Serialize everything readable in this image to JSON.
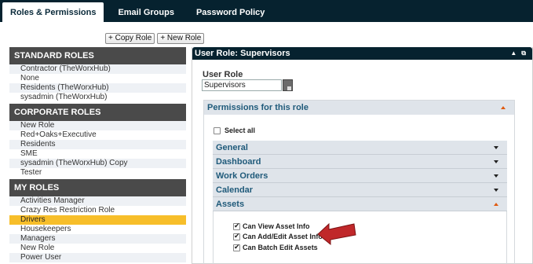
{
  "nav": {
    "tabs": [
      {
        "label": "Roles & Permissions"
      },
      {
        "label": "Email Groups"
      },
      {
        "label": "Password Policy"
      }
    ]
  },
  "toolbar": {
    "copy_role": "+ Copy Role",
    "new_role": "+ New Role"
  },
  "role_groups": [
    {
      "title": "STANDARD ROLES",
      "items": [
        "Contractor (TheWorxHub)",
        "None",
        "Residents (TheWorxHub)",
        "sysadmin (TheWorxHub)"
      ]
    },
    {
      "title": "CORPORATE ROLES",
      "items": [
        "New Role",
        "Red+Oaks+Executive",
        "Residents",
        "SME",
        "sysadmin (TheWorxHub) Copy",
        "Tester"
      ]
    },
    {
      "title": "MY ROLES",
      "items": [
        "Activities Manager",
        "Crazy Res Restriction Role",
        "Drivers",
        "Housekeepers",
        "Managers",
        "New Role",
        "Power User"
      ]
    }
  ],
  "selected_role": "Drivers",
  "panel": {
    "title": "User Role: Supervisors",
    "controls": [
      "▲",
      "⧉"
    ],
    "role_label": "User Role",
    "role_value": "Supervisors",
    "permissions_title": "Permissions for this role",
    "select_all": "Select all",
    "sections": [
      {
        "label": "General",
        "expanded": false
      },
      {
        "label": "Dashboard",
        "expanded": false
      },
      {
        "label": "Work Orders",
        "expanded": false
      },
      {
        "label": "Calendar",
        "expanded": false
      },
      {
        "label": "Assets",
        "expanded": true
      }
    ],
    "asset_permissions": [
      {
        "label": "Can View Asset Info",
        "checked": true
      },
      {
        "label": "Can Add/Edit Asset Info",
        "checked": true
      },
      {
        "label": "Can Batch Edit Assets",
        "checked": true
      }
    ]
  },
  "colors": {
    "nav_bg": "#06222f",
    "group_header_bg": "#4a4a4a",
    "selected_row": "#f7be2a",
    "section_text": "#1f5a7a",
    "arrow": "#c0282a"
  }
}
